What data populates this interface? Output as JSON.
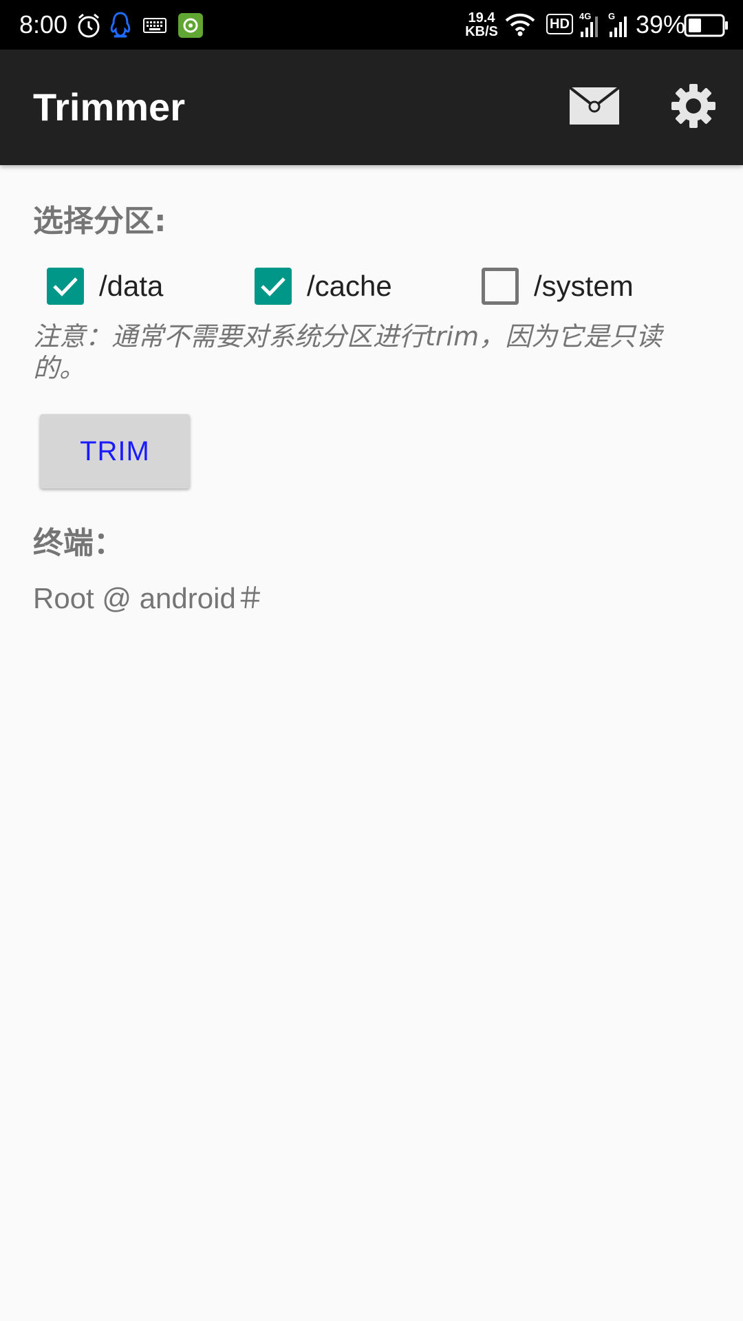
{
  "status_bar": {
    "time": "8:00",
    "net_speed_value": "19.4",
    "net_speed_unit": "KB/S",
    "hd_label": "HD",
    "net_type_1": "4G",
    "net_type_2": "G",
    "battery_text": "39%",
    "battery_level": 0.39,
    "icons": [
      "alarm-icon",
      "qq-icon",
      "keyboard-icon",
      "app-settings-icon",
      "wifi-icon",
      "signal-icon",
      "battery-icon"
    ]
  },
  "app_bar": {
    "title": "Trimmer",
    "actions": [
      "mail-icon",
      "settings-gear-icon"
    ]
  },
  "partition": {
    "heading": "选择分区:",
    "options": [
      {
        "label": "/data",
        "checked": true
      },
      {
        "label": "/cache",
        "checked": true
      },
      {
        "label": "/system",
        "checked": false
      }
    ],
    "note": "注意：通常不需要对系统分区进行trim，因为它是只读的。"
  },
  "trim_button": {
    "label": "TRIM"
  },
  "terminal": {
    "heading": "终端：",
    "prompt": "Root @ android＃"
  },
  "colors": {
    "status_bar_bg": "#000000",
    "app_bar_bg": "#212121",
    "page_bg": "#fafafa",
    "accent": "#009688",
    "button_text": "#1a1aff",
    "secondary_text": "#757575"
  }
}
